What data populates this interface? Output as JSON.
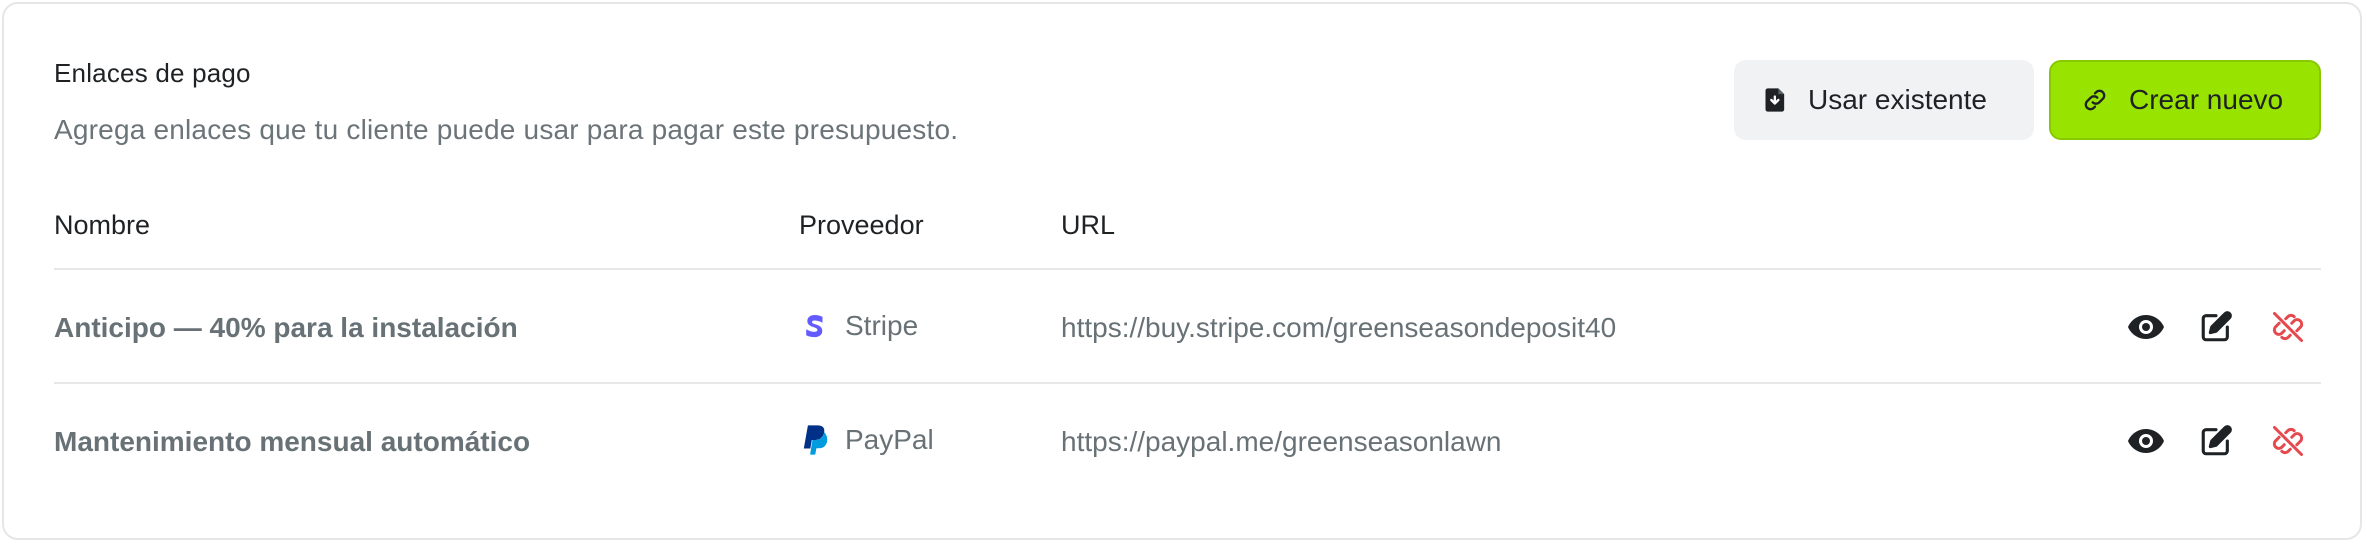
{
  "header": {
    "title": "Enlaces de pago",
    "subtitle": "Agrega enlaces que tu cliente puede usar para pagar este presupuesto."
  },
  "actions": {
    "use_existing_label": "Usar existente",
    "create_new_label": "Crear nuevo"
  },
  "table": {
    "columns": [
      "Nombre",
      "Proveedor",
      "URL"
    ],
    "rows": [
      {
        "name": "Anticipo — 40% para la instalación",
        "provider": "Stripe",
        "provider_icon": "stripe-logo-icon",
        "url": "https://buy.stripe.com/greenseasondeposit40"
      },
      {
        "name": "Mantenimiento mensual automático",
        "provider": "PayPal",
        "provider_icon": "paypal-logo-icon",
        "url": "https://paypal.me/greenseasonlawn"
      }
    ],
    "row_actions": [
      "eye-icon",
      "edit-icon",
      "unlink-icon"
    ]
  },
  "colors": {
    "accent": "#99e300",
    "danger": "#e5484d",
    "muted_text": "#687276",
    "stripe": "#635bff",
    "paypal_dark": "#003087",
    "paypal_light": "#009cde"
  }
}
